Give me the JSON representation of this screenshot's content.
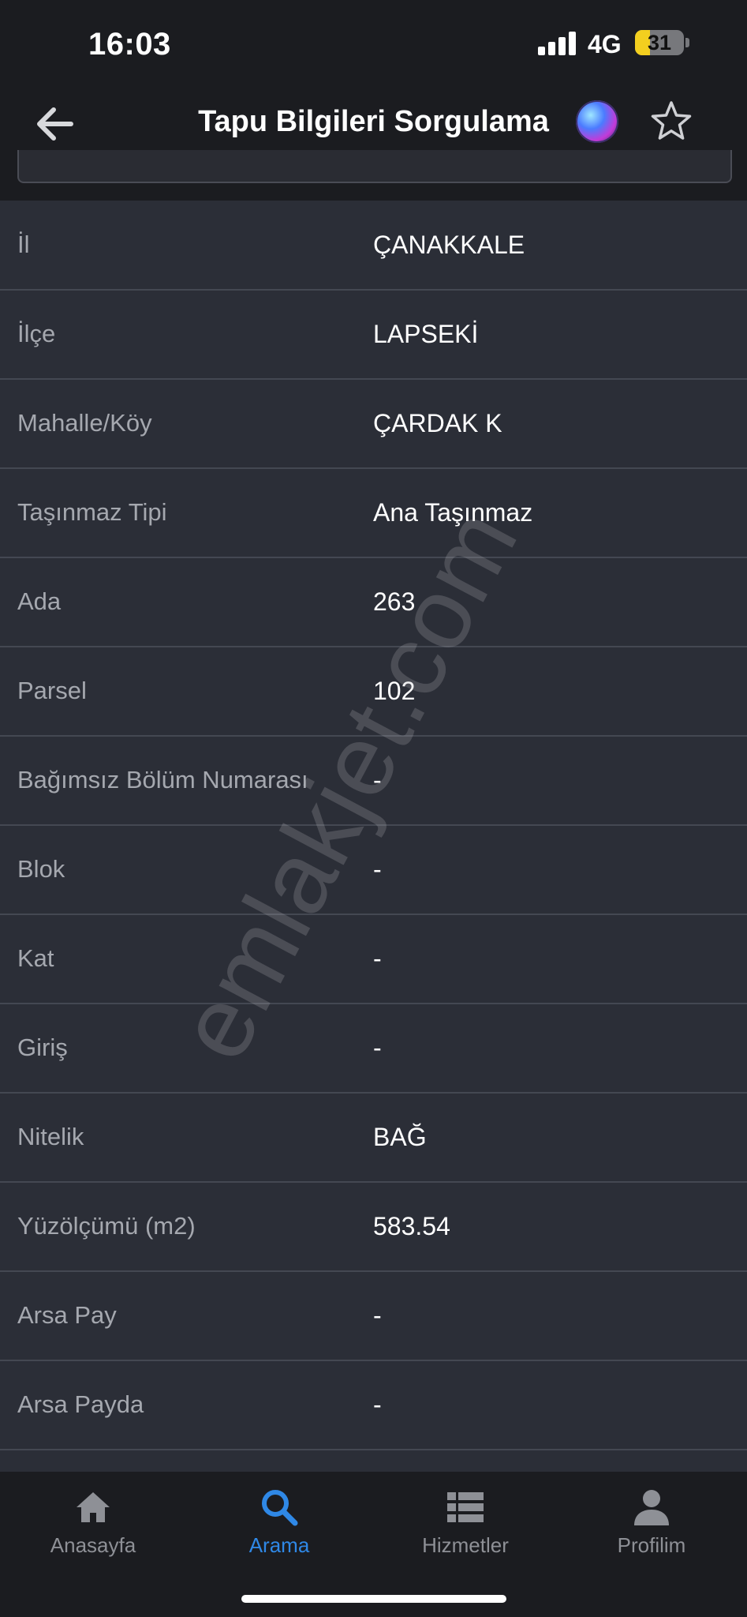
{
  "status_bar": {
    "time": "16:03",
    "network": "4G",
    "battery": "31",
    "battery_fraction": 0.31
  },
  "nav": {
    "title": "Tapu Bilgileri Sorgulama"
  },
  "rows": [
    {
      "label": "İl",
      "value": "ÇANAKKALE"
    },
    {
      "label": "İlçe",
      "value": "LAPSEKİ"
    },
    {
      "label": "Mahalle/Köy",
      "value": "ÇARDAK K"
    },
    {
      "label": "Taşınmaz Tipi",
      "value": "Ana Taşınmaz"
    },
    {
      "label": "Ada",
      "value": "263"
    },
    {
      "label": "Parsel",
      "value": "102"
    },
    {
      "label": "Bağımsız Bölüm Numarası",
      "value": "-"
    },
    {
      "label": "Blok",
      "value": "-"
    },
    {
      "label": "Kat",
      "value": "-"
    },
    {
      "label": "Giriş",
      "value": "-"
    },
    {
      "label": "Nitelik",
      "value": "BAĞ"
    },
    {
      "label": "Yüzölçümü (m2)",
      "value": "583.54"
    },
    {
      "label": "Arsa Pay",
      "value": "-"
    },
    {
      "label": "Arsa Payda",
      "value": "-"
    }
  ],
  "watermark": "emlakjet.com",
  "tabs": [
    {
      "label": "Anasayfa",
      "icon": "home-icon",
      "active": false
    },
    {
      "label": "Arama",
      "icon": "search-icon",
      "active": true
    },
    {
      "label": "Hizmetler",
      "icon": "list-icon",
      "active": false
    },
    {
      "label": "Profilim",
      "icon": "user-icon",
      "active": false
    }
  ],
  "colors": {
    "accent": "#2f88e6",
    "background": "#1b1c20",
    "table": "#2b2e37",
    "battery": "#f3cf1f"
  }
}
